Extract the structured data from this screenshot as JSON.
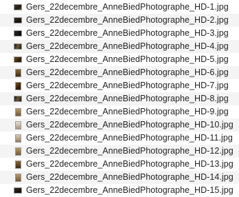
{
  "files": [
    {
      "name": "Gers_22decembre_AnneBiedPhotographe_HD-1.jpg",
      "icon": "image-thumbnail-icon"
    },
    {
      "name": "Gers_22decembre_AnneBiedPhotographe_HD-2.jpg",
      "icon": "image-thumbnail-icon"
    },
    {
      "name": "Gers_22decembre_AnneBiedPhotographe_HD-3.jpg",
      "icon": "image-thumbnail-icon"
    },
    {
      "name": "Gers_22decembre_AnneBiedPhotographe_HD-4.jpg",
      "icon": "image-thumbnail-icon"
    },
    {
      "name": "Gers_22decembre_AnneBiedPhotographe_HD-5.jpg",
      "icon": "image-thumbnail-icon"
    },
    {
      "name": "Gers_22decembre_AnneBiedPhotographe_HD-6.jpg",
      "icon": "image-thumbnail-icon"
    },
    {
      "name": "Gers_22decembre_AnneBiedPhotographe_HD-7.jpg",
      "icon": "image-thumbnail-icon"
    },
    {
      "name": "Gers_22decembre_AnneBiedPhotographe_HD-8.jpg",
      "icon": "image-thumbnail-icon"
    },
    {
      "name": "Gers_22decembre_AnneBiedPhotographe_HD-9.jpg",
      "icon": "image-thumbnail-icon"
    },
    {
      "name": "Gers_22decembre_AnneBiedPhotographe_HD-10.jpg",
      "icon": "image-thumbnail-icon"
    },
    {
      "name": "Gers_22decembre_AnneBiedPhotographe_HD-11.jpg",
      "icon": "image-thumbnail-icon"
    },
    {
      "name": "Gers_22decembre_AnneBiedPhotographe_HD-12.jpg",
      "icon": "image-thumbnail-icon"
    },
    {
      "name": "Gers_22decembre_AnneBiedPhotographe_HD-13.jpg",
      "icon": "image-thumbnail-icon"
    },
    {
      "name": "Gers_22decembre_AnneBiedPhotographe_HD-14.jpg",
      "icon": "image-thumbnail-icon"
    },
    {
      "name": "Gers_22decembre_AnneBiedPhotographe_HD-15.jpg",
      "icon": "image-thumbnail-icon"
    }
  ],
  "colors": {
    "text": "#222222",
    "row_alt": "#f4f4f4",
    "background": "#ffffff"
  }
}
